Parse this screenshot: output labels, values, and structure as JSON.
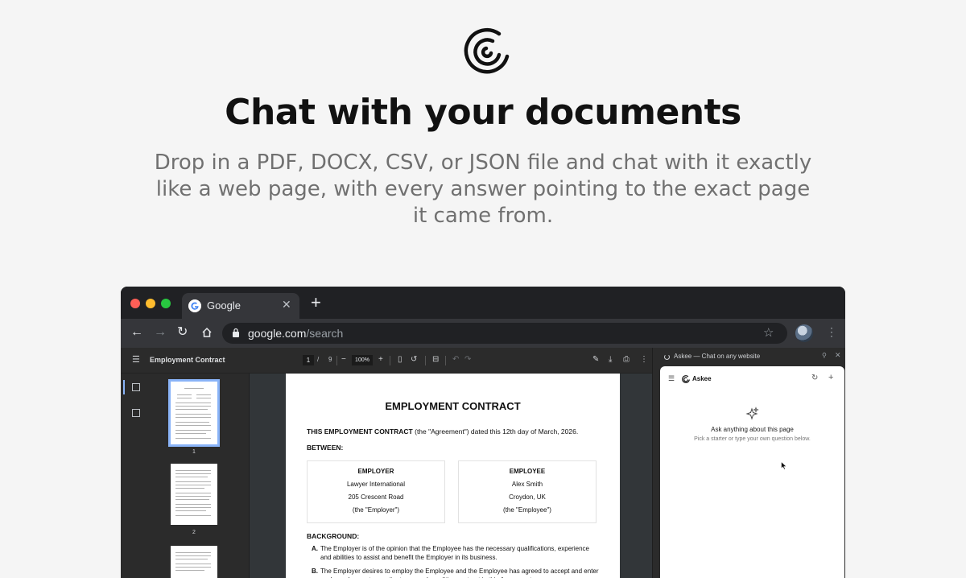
{
  "hero": {
    "title": "Chat with your documents",
    "subtitle": "Drop in a PDF, DOCX, CSV, or JSON file and chat with it exactly like a web page, with every answer pointing to the exact page it came from."
  },
  "browser": {
    "tab_title": "Google",
    "url_host": "google.com",
    "url_path": "/search"
  },
  "pdf_viewer": {
    "file_title": "Employment Contract",
    "current_page": "1",
    "page_separator": "/",
    "total_pages": "9",
    "zoom": "100%",
    "thumbnail_numbers": [
      "1",
      "2"
    ]
  },
  "document": {
    "title": "EMPLOYMENT CONTRACT",
    "intro_bold": "THIS EMPLOYMENT CONTRACT",
    "intro_rest": " (the \"Agreement\") dated this 12th day of March, 2026.",
    "between": "BETWEEN:",
    "employer": {
      "heading": "EMPLOYER",
      "name": "Lawyer International",
      "address": "205 Crescent Road",
      "alias": "(the \"Employer\")"
    },
    "employee": {
      "heading": "EMPLOYEE",
      "name": "Alex Smith",
      "address": "Croydon, UK",
      "alias": "(the \"Employee\")"
    },
    "background": "BACKGROUND:",
    "clauses": [
      {
        "key": "A.",
        "text": "The Employer is of the opinion that the Employee has the necessary qualifications, experience and abilities to assist and benefit the Employer in its business."
      },
      {
        "key": "B.",
        "text": "The Employer desires to employ the Employee and the Employee has agreed to accept and enter such employment upon the terms and conditions set out in this Agreement."
      }
    ]
  },
  "askee": {
    "panel_title": "Askee — Chat on any website",
    "brand": "Askee",
    "empty_heading": "Ask anything about this page",
    "empty_sub": "Pick a starter or type your own question below."
  }
}
